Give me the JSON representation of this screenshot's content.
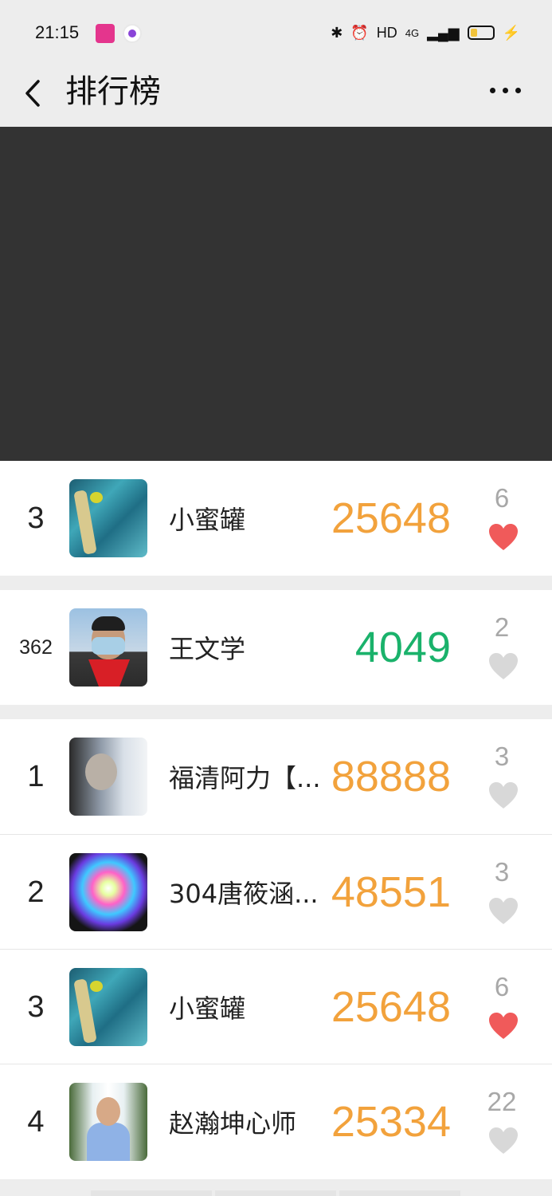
{
  "status": {
    "time": "21:15",
    "hd": "HD",
    "network": "4G"
  },
  "nav": {
    "title": "排行榜"
  },
  "my_entry": {
    "rank": "3",
    "name": "小蜜罐",
    "score": "25648",
    "likes": "6",
    "liked": true
  },
  "my_gap_entry": {
    "rank": "362",
    "name": "王文学",
    "score": "4049",
    "likes": "2",
    "liked": false
  },
  "leaderboard": [
    {
      "rank": "1",
      "name": "福清阿力【...",
      "score": "88888",
      "likes": "3",
      "liked": false
    },
    {
      "rank": "2",
      "name": "304唐筱涵...",
      "score": "48551",
      "likes": "3",
      "liked": false
    },
    {
      "rank": "3",
      "name": "小蜜罐",
      "score": "25648",
      "likes": "6",
      "liked": true
    },
    {
      "rank": "4",
      "name": "赵瀚坤心师",
      "score": "25334",
      "likes": "22",
      "liked": false
    }
  ],
  "colors": {
    "score_orange": "#f2a23c",
    "score_green": "#1ab26b",
    "heart_red": "#f05a5a",
    "heart_grey": "#d8d8d8"
  }
}
